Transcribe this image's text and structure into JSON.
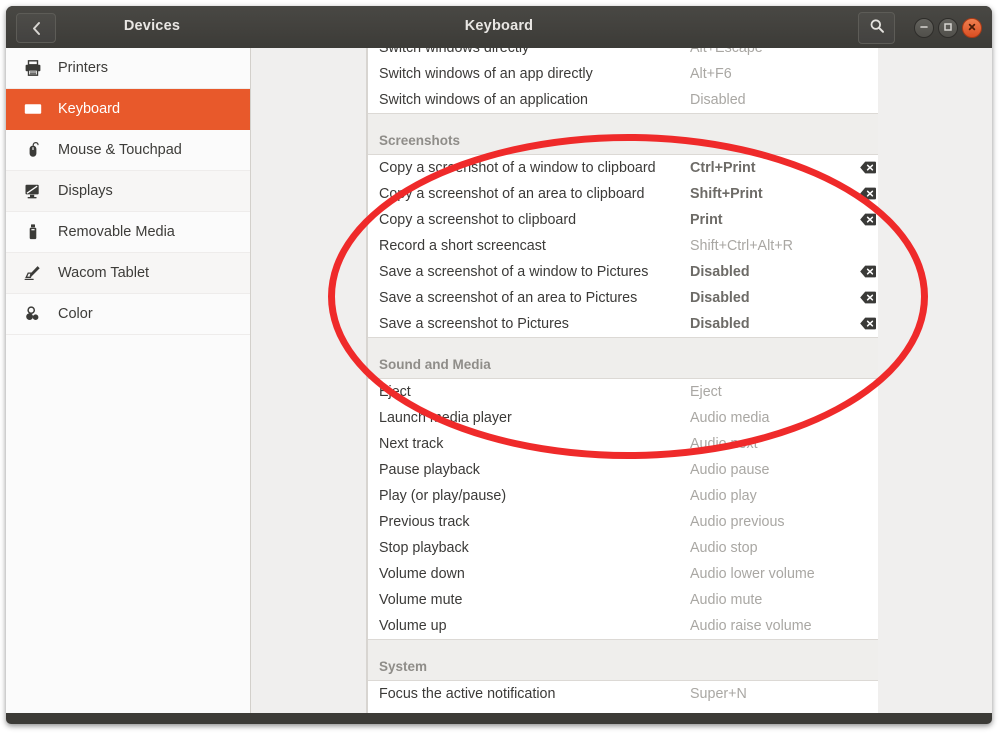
{
  "window": {
    "panel_title": "Devices",
    "page_title": "Keyboard",
    "back_icon": "chevron-left-icon",
    "search_icon": "search-icon",
    "minimize_icon": "minimize-icon",
    "maximize_icon": "maximize-icon",
    "close_icon": "close-icon",
    "accent_color": "#e8592b",
    "titlebar_color": "#3c3b37",
    "annotation_color": "#ef2a2a"
  },
  "sidebar": {
    "items": [
      {
        "label": "Printers",
        "icon": "printer-icon",
        "active": false
      },
      {
        "label": "Keyboard",
        "icon": "keyboard-icon",
        "active": true
      },
      {
        "label": "Mouse & Touchpad",
        "icon": "mouse-icon",
        "active": false
      },
      {
        "label": "Displays",
        "icon": "display-icon",
        "active": false
      },
      {
        "label": "Removable Media",
        "icon": "usb-drive-icon",
        "active": false
      },
      {
        "label": "Wacom Tablet",
        "icon": "wacom-tablet-icon",
        "active": false
      },
      {
        "label": "Color",
        "icon": "color-palette-icon",
        "active": false
      }
    ]
  },
  "shortcuts": {
    "clear_icon": "backspace-clear-icon",
    "sections": [
      {
        "title": null,
        "rows": [
          {
            "label": "Switch windows directly",
            "accel": "Alt+Escape",
            "state": "unset",
            "clear": false
          },
          {
            "label": "Switch windows of an app directly",
            "accel": "Alt+F6",
            "state": "unset",
            "clear": false
          },
          {
            "label": "Switch windows of an application",
            "accel": "Disabled",
            "state": "unset",
            "clear": false
          }
        ]
      },
      {
        "title": "Screenshots",
        "rows": [
          {
            "label": "Copy a screenshot of a window to clipboard",
            "accel": "Ctrl+Print",
            "state": "set",
            "clear": true
          },
          {
            "label": "Copy a screenshot of an area to clipboard",
            "accel": "Shift+Print",
            "state": "set",
            "clear": true
          },
          {
            "label": "Copy a screenshot to clipboard",
            "accel": "Print",
            "state": "set",
            "clear": true
          },
          {
            "label": "Record a short screencast",
            "accel": "Shift+Ctrl+Alt+R",
            "state": "unset",
            "clear": false
          },
          {
            "label": "Save a screenshot of a window to Pictures",
            "accel": "Disabled",
            "state": "set",
            "clear": true
          },
          {
            "label": "Save a screenshot of an area to Pictures",
            "accel": "Disabled",
            "state": "set",
            "clear": true
          },
          {
            "label": "Save a screenshot to Pictures",
            "accel": "Disabled",
            "state": "set",
            "clear": true
          }
        ]
      },
      {
        "title": "Sound and Media",
        "rows": [
          {
            "label": "Eject",
            "accel": "Eject",
            "state": "unset",
            "clear": false
          },
          {
            "label": "Launch media player",
            "accel": "Audio media",
            "state": "unset",
            "clear": false
          },
          {
            "label": "Next track",
            "accel": "Audio next",
            "state": "unset",
            "clear": false
          },
          {
            "label": "Pause playback",
            "accel": "Audio pause",
            "state": "unset",
            "clear": false
          },
          {
            "label": "Play (or play/pause)",
            "accel": "Audio play",
            "state": "unset",
            "clear": false
          },
          {
            "label": "Previous track",
            "accel": "Audio previous",
            "state": "unset",
            "clear": false
          },
          {
            "label": "Stop playback",
            "accel": "Audio stop",
            "state": "unset",
            "clear": false
          },
          {
            "label": "Volume down",
            "accel": "Audio lower volume",
            "state": "unset",
            "clear": false
          },
          {
            "label": "Volume mute",
            "accel": "Audio mute",
            "state": "unset",
            "clear": false
          },
          {
            "label": "Volume up",
            "accel": "Audio raise volume",
            "state": "unset",
            "clear": false
          }
        ]
      },
      {
        "title": "System",
        "rows": [
          {
            "label": "Focus the active notification",
            "accel": "Super+N",
            "state": "unset",
            "clear": false
          }
        ]
      }
    ]
  }
}
